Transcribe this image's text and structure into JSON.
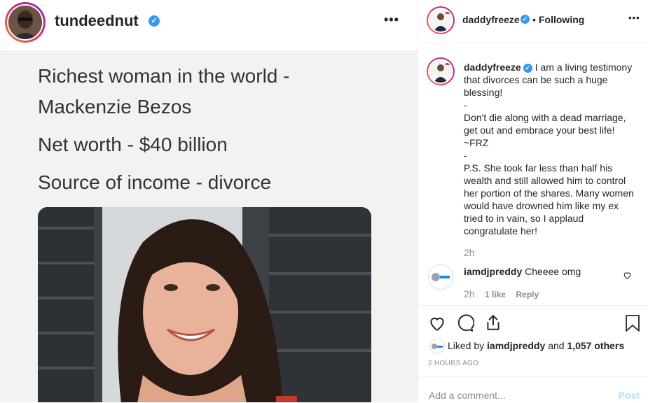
{
  "post": {
    "username": "tundeednut",
    "more_icon": "ellipsis-icon",
    "meme_lines": [
      "Richest woman in the world -",
      "Mackenzie Bezos",
      "Net worth - $40 billion",
      "Source of income - divorce"
    ]
  },
  "panel": {
    "header": {
      "username": "daddyfreeze",
      "separator": "•",
      "follow_status": "Following"
    },
    "caption": {
      "username": "daddyfreeze",
      "lines": [
        "I am a living testimony that divorces can be such a huge blessing!",
        "-",
        "Don't die along with a dead marriage, get out and embrace your best life!",
        "~FRZ",
        "-",
        "P.S. She took far less than half his wealth and still allowed him to control her portion of the shares. Many women would have drowned him like my ex tried to in vain, so I applaud congratulate her!"
      ],
      "time": "2h"
    },
    "comment": {
      "username": "iamdjpreddy",
      "text": "Cheeee omg",
      "time": "2h",
      "likes": "1 like",
      "reply": "Reply"
    },
    "likes": {
      "prefix": "Liked by",
      "user": "iamdjpreddy",
      "and": "and",
      "others": "1,057 others"
    },
    "timestamp": "2 HOURS AGO",
    "add_comment": {
      "placeholder": "Add a comment...",
      "post_label": "Post"
    }
  },
  "colors": {
    "verified": "#3897f0",
    "post_disabled": "#b2dffc",
    "muted": "#8e8e8e"
  }
}
